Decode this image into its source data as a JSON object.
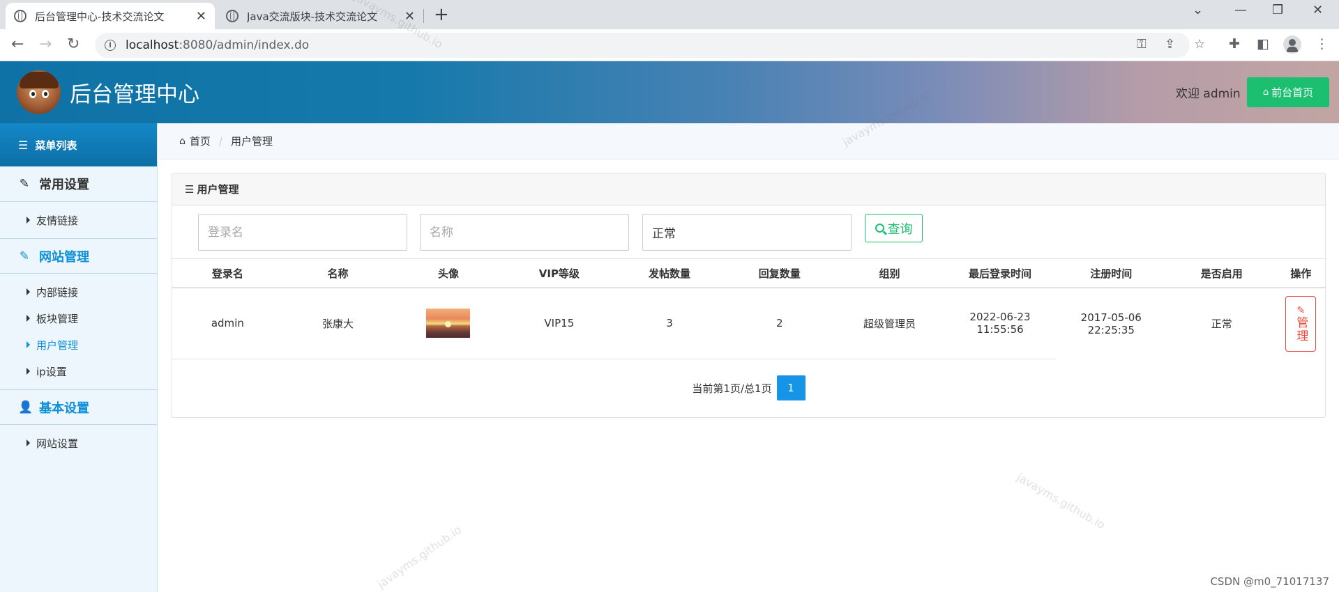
{
  "browser": {
    "tabs": [
      {
        "title": "后台管理中心-技术交流论文",
        "active": true
      },
      {
        "title": "Java交流版块-技术交流论文",
        "active": false
      }
    ],
    "url_host": "localhost",
    "url_rest": ":8080/admin/index.do"
  },
  "header": {
    "title": "后台管理中心",
    "welcome": "欢迎 admin",
    "home_button": "前台首页"
  },
  "sidebar": {
    "menu_title": "菜单列表",
    "groups": [
      {
        "label": "常用设置",
        "icon": "edit-icon",
        "items": [
          {
            "label": "友情链接"
          }
        ]
      },
      {
        "label": "网站管理",
        "icon": "edit-icon",
        "items": [
          {
            "label": "内部链接"
          },
          {
            "label": "板块管理"
          },
          {
            "label": "用户管理",
            "active": true
          },
          {
            "label": "ip设置"
          }
        ]
      },
      {
        "label": "基本设置",
        "icon": "user-icon",
        "items": [
          {
            "label": "网站设置"
          }
        ]
      }
    ]
  },
  "breadcrumb": {
    "home": "首页",
    "current": "用户管理"
  },
  "panel": {
    "title": "用户管理",
    "filters": {
      "login_placeholder": "登录名",
      "name_placeholder": "名称",
      "status_value": "正常",
      "query_button": "查询"
    },
    "columns": [
      "登录名",
      "名称",
      "头像",
      "VIP等级",
      "发帖数量",
      "回复数量",
      "组别",
      "最后登录时间",
      "注册时间",
      "是否启用",
      "操作"
    ],
    "rows": [
      {
        "login": "admin",
        "name": "张康大",
        "vip": "VIP15",
        "posts": "3",
        "replies": "2",
        "group": "超级管理员",
        "last_login_date": "2022-06-23",
        "last_login_time": "11:55:56",
        "register_date": "2017-05-06",
        "register_time": "22:25:35",
        "enabled": "正常",
        "action": "管理"
      }
    ],
    "pager": {
      "text": "当前第1页/总1页",
      "current_page": "1"
    }
  },
  "watermark": "javayms.github.io",
  "csdn_credit": "CSDN @m0_71017137"
}
